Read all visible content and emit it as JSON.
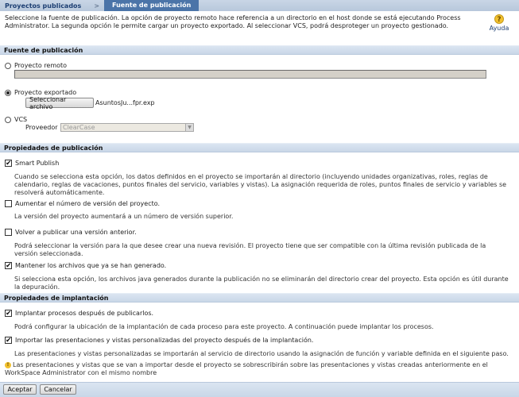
{
  "breadcrumb": {
    "parent": "Proyectos publicados",
    "separator": ">",
    "current": "Fuente de publicación"
  },
  "intro": {
    "text": "Seleccione la fuente de publicación. La opción de proyecto remoto hace referencia a un directorio en el host donde se está ejecutando Process Administrator. La segunda opción le permite cargar un proyecto exportado. Al seleccionar VCS, podrá desproteger un proyecto gestionado."
  },
  "help": {
    "label": "Ayuda",
    "icon": "?"
  },
  "source_section": {
    "title": "Fuente de publicación",
    "remote": {
      "label": "Proyecto remoto",
      "selected": false,
      "value": ""
    },
    "exported": {
      "label": "Proyecto exportado",
      "selected": true,
      "button": "Seleccionar archivo",
      "file": "AsuntosJu...fpr.exp"
    },
    "vcs": {
      "label": "VCS",
      "selected": false,
      "provider_label": "Proveedor",
      "provider_value": "ClearCase",
      "arrow": "▼"
    }
  },
  "publish_section": {
    "title": "Propiedades de publicación",
    "options": [
      {
        "label": "Smart Publish",
        "checked": true,
        "description": "Cuando se selecciona esta opción, los datos definidos en el proyecto se importarán al directorio (incluyendo unidades organizativas, roles, reglas de calendario, reglas de vacaciones, puntos finales del servicio, variables y vistas). La asignación requerida de roles, puntos finales de servicio y variables se resolverá automáticamente."
      },
      {
        "label": "Aumentar el número de versión del proyecto.",
        "checked": false,
        "description": "La versión del proyecto aumentará a un número de versión superior."
      },
      {
        "label": "Volver a publicar una versión anterior.",
        "checked": false,
        "description": "Podrá seleccionar la versión para la que desee crear una nueva revisión. El proyecto tiene que ser compatible con la última revisión publicada de la versión seleccionada."
      },
      {
        "label": "Mantener los archivos que ya se han generado.",
        "checked": true,
        "description": "Si selecciona esta opción, los archivos java generados durante la publicación no se eliminarán del directorio crear del proyecto. Esta opción es útil durante la depuración."
      }
    ]
  },
  "deploy_section": {
    "title": "Propiedades de implantación",
    "options": [
      {
        "label": "Implantar procesos después de publicarlos.",
        "checked": true,
        "description": "Podrá configurar la ubicación de la implantación de cada proceso para este proyecto. A continuación puede implantar los procesos."
      },
      {
        "label": "Importar las presentaciones y vistas personalizadas del proyecto después de la implantación.",
        "checked": true,
        "description": "Las presentaciones y vistas personalizadas se importarán al servicio de directorio usando la asignación de función y variable definida en el siguiente paso."
      }
    ],
    "warning": "Las presentaciones y vistas que se van a importar desde el proyecto se sobrescribirán sobre las presentaciones y vistas creadas anteriormente en el WorkSpace Administrator con el mismo nombre",
    "warning_icon": "!"
  },
  "footer": {
    "accept": "Aceptar",
    "cancel": "Cancelar"
  },
  "check_glyph": "✔"
}
